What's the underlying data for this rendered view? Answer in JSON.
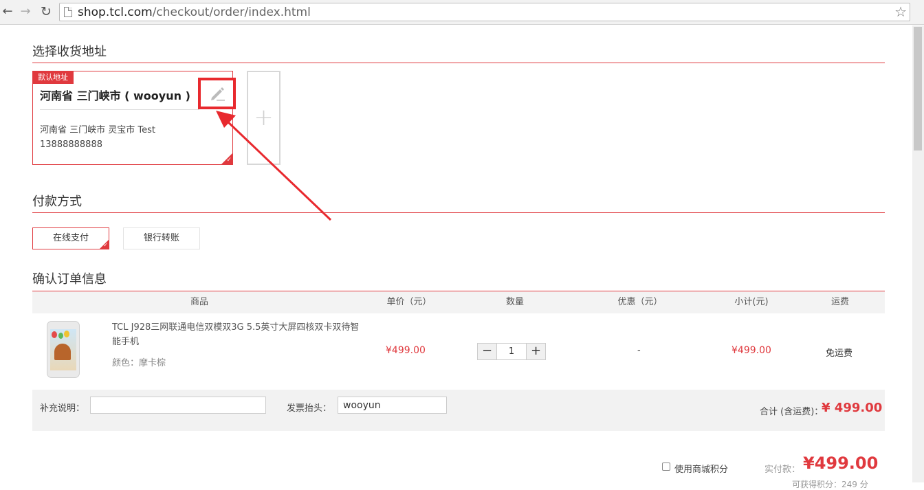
{
  "browser": {
    "url_host": "shop.tcl.com",
    "url_path": "/checkout/order/index.html"
  },
  "address_section": {
    "title": "选择收货地址",
    "default_tag": "默认地址",
    "card": {
      "name": "河南省 三门峡市 ( wooyun )",
      "address": "河南省 三门峡市 灵宝市 Test",
      "phone": "13888888888",
      "selected": true
    },
    "add_symbol": "+"
  },
  "payment_section": {
    "title": "付款方式",
    "options": [
      "在线支付",
      "银行转账"
    ],
    "selected_index": 0
  },
  "order_section": {
    "title": "确认订单信息",
    "columns": [
      "商品",
      "单价（元）",
      "数量",
      "优惠（元）",
      "小计(元)",
      "运费"
    ],
    "item": {
      "name": "TCL J928三网联通电信双模双3G 5.5英寸大屏四核双卡双待智能手机",
      "color": "颜色：摩卡棕",
      "unit_price": "¥499.00",
      "quantity": "1",
      "discount": "-",
      "subtotal": "¥499.00",
      "shipping": "免运费"
    },
    "remark_label": "补充说明：",
    "remark_value": "",
    "invoice_label": "发票抬头：",
    "invoice_value": "wooyun",
    "total_label": "合计 (含运费)：",
    "total_value": "¥ 499.00"
  },
  "footer": {
    "use_points_label": "使用商城积分",
    "use_points_checked": false,
    "actual_pay_label": "实付款：",
    "actual_pay_value": "¥499.00",
    "cut_text": "可获得积分：249 分"
  },
  "colors": {
    "accent": "#e0393e",
    "highlight": "#e8292e"
  }
}
